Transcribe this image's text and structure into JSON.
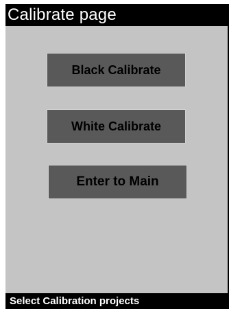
{
  "header": {
    "title": "Calibrate page"
  },
  "menu": {
    "items": [
      {
        "label": "Black Calibrate"
      },
      {
        "label": "White Calibrate"
      },
      {
        "label": "Enter to Main"
      }
    ]
  },
  "status": {
    "text": "Select Calibration projects"
  },
  "colors": {
    "screen_bg": "#c4c4c4",
    "button_bg": "#595959",
    "bar_bg": "#000000",
    "bar_text": "#ffffff"
  }
}
